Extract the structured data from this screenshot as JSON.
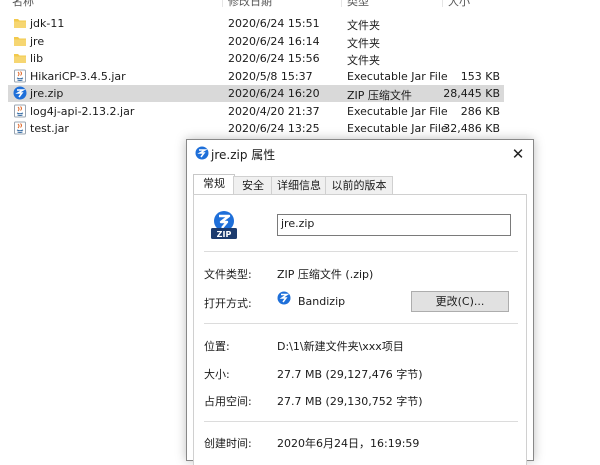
{
  "columns": {
    "name": "名称",
    "date": "修改日期",
    "type": "类型",
    "size": "大小"
  },
  "files": [
    {
      "name": "jdk-11",
      "date": "2020/6/24 15:51",
      "type": "文件夹",
      "size": "",
      "icon": "folder-icon"
    },
    {
      "name": "jre",
      "date": "2020/6/24 16:14",
      "type": "文件夹",
      "size": "",
      "icon": "folder-icon"
    },
    {
      "name": "lib",
      "date": "2020/6/24 15:56",
      "type": "文件夹",
      "size": "",
      "icon": "folder-icon"
    },
    {
      "name": "HikariCP-3.4.5.jar",
      "date": "2020/5/8 15:37",
      "type": "Executable Jar File",
      "size": "153 KB",
      "icon": "java-jar-icon"
    },
    {
      "name": "jre.zip",
      "date": "2020/6/24 16:20",
      "type": "ZIP 压缩文件",
      "size": "28,445 KB",
      "icon": "bandizip-zip-icon",
      "selected": true
    },
    {
      "name": "log4j-api-2.13.2.jar",
      "date": "2020/4/20 21:37",
      "type": "Executable Jar File",
      "size": "286 KB",
      "icon": "java-jar-icon"
    },
    {
      "name": "test.jar",
      "date": "2020/6/24 13:25",
      "type": "Executable Jar File",
      "size": "32,486 KB",
      "icon": "java-jar-icon"
    }
  ],
  "dialog": {
    "title": "jre.zip 属性",
    "close": "✕",
    "tabs": [
      "常规",
      "安全",
      "详细信息",
      "以前的版本"
    ],
    "active_tab": "常规",
    "filename": "jre.zip",
    "file_type_label": "文件类型:",
    "file_type_value": "ZIP 压缩文件 (.zip)",
    "open_with_label": "打开方式:",
    "open_with_value": "Bandizip",
    "change_button": "更改(C)...",
    "location_label": "位置:",
    "location_value": "D:\\1\\新建文件夹\\xxx项目",
    "size_label": "大小:",
    "size_value": "27.7 MB (29,127,476 字节)",
    "disk_size_label": "占用空间:",
    "disk_size_value": "27.7 MB (29,130,752 字节)",
    "created_label": "创建时间:",
    "created_value": "2020年6月24日，16:19:59"
  },
  "colors": {
    "folder": "#f2c94c",
    "zip_blue": "#1e6fd9",
    "zip_dark": "#1c3b6e",
    "selected_row": "#d9d9d9"
  }
}
